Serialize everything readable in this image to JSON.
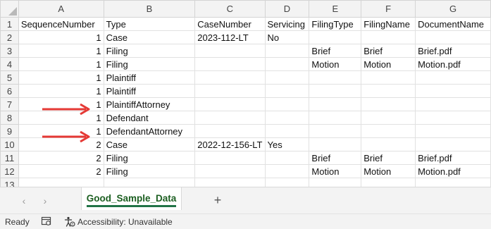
{
  "columns": [
    "A",
    "B",
    "C",
    "D",
    "E",
    "F",
    "G"
  ],
  "rows": [
    {
      "num": "1",
      "cells": [
        "SequenceNumber",
        "Type",
        "CaseNumber",
        "Servicing",
        "FilingType",
        "FilingName",
        "DocumentName"
      ]
    },
    {
      "num": "2",
      "cells": [
        "1",
        "Case",
        "2023-112-LT",
        "No",
        "",
        "",
        ""
      ]
    },
    {
      "num": "3",
      "cells": [
        "1",
        "Filing",
        "",
        "",
        "Brief",
        "Brief",
        "Brief.pdf"
      ]
    },
    {
      "num": "4",
      "cells": [
        "1",
        "Filing",
        "",
        "",
        "Motion",
        "Motion",
        "Motion.pdf"
      ]
    },
    {
      "num": "5",
      "cells": [
        "1",
        "Plaintiff",
        "",
        "",
        "",
        "",
        ""
      ]
    },
    {
      "num": "6",
      "cells": [
        "1",
        "Plaintiff",
        "",
        "",
        "",
        "",
        ""
      ]
    },
    {
      "num": "7",
      "cells": [
        "1",
        "PlaintiffAttorney",
        "",
        "",
        "",
        "",
        ""
      ]
    },
    {
      "num": "8",
      "cells": [
        "1",
        "Defendant",
        "",
        "",
        "",
        "",
        ""
      ]
    },
    {
      "num": "9",
      "cells": [
        "1",
        "DefendantAttorney",
        "",
        "",
        "",
        "",
        ""
      ]
    },
    {
      "num": "10",
      "cells": [
        "2",
        "Case",
        "2022-12-156-LT",
        "Yes",
        "",
        "",
        ""
      ]
    },
    {
      "num": "11",
      "cells": [
        "2",
        "Filing",
        "",
        "",
        "Brief",
        "Brief",
        "Brief.pdf"
      ]
    },
    {
      "num": "12",
      "cells": [
        "2",
        "Filing",
        "",
        "",
        "Motion",
        "Motion",
        "Motion.pdf"
      ]
    },
    {
      "num": "13",
      "cells": [
        "",
        "",
        "",
        "",
        "",
        "",
        ""
      ]
    }
  ],
  "arrow_color": "#e53935",
  "sheet_tab": {
    "label": "Good_Sample_Data",
    "accent": "#217346"
  },
  "tab_nav": {
    "prev_icon": "‹",
    "next_icon": "›",
    "add_icon": "+"
  },
  "status": {
    "ready": "Ready",
    "accessibility": "Accessibility: Unavailable"
  },
  "icons": [
    "corner-select-icon",
    "arrow-icon",
    "prev-sheet-icon",
    "next-sheet-icon",
    "add-sheet-icon",
    "macro-icon",
    "accessibility-icon"
  ]
}
